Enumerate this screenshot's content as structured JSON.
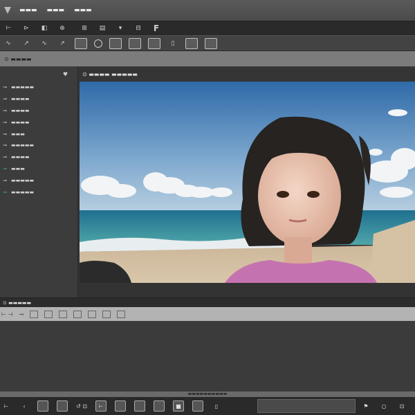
{
  "menubar": {
    "items": [
      "▬▬▬",
      "▬▬▬",
      "▬▬▬"
    ]
  },
  "toolbar1": {
    "tools": [
      "⊢",
      "⊳",
      "◧",
      "⊕",
      "⊞",
      "▤",
      "▾",
      "⊟",
      "F"
    ]
  },
  "toolbar2": {
    "tools": [
      "◦",
      "◦",
      "◦",
      "◦",
      "◦"
    ]
  },
  "strip": {
    "label": "⊙ ▬▬▬▬"
  },
  "left_panel": {
    "items": [
      {
        "icon": "⊸",
        "label": "▬▬▬▬▬",
        "green": false
      },
      {
        "icon": "⊸",
        "label": "▬▬▬▬",
        "green": false
      },
      {
        "icon": "⊸",
        "label": "▬▬▬▬",
        "green": false
      },
      {
        "icon": "⊸",
        "label": "▬▬▬▬",
        "green": false
      },
      {
        "icon": "⊸",
        "label": "▬▬▬",
        "green": false
      },
      {
        "icon": "⊸",
        "label": "▬▬▬▬▬",
        "green": false
      },
      {
        "icon": "⊸",
        "label": "▬▬▬▬",
        "green": false
      },
      {
        "icon": "⊸",
        "label": "▬▬▬",
        "green": true
      },
      {
        "icon": "⊸",
        "label": "▬▬▬▬▬",
        "green": false
      },
      {
        "icon": "⊸",
        "label": "▬▬▬▬▬",
        "green": true
      }
    ]
  },
  "viewer": {
    "title": "⊙ ▬▬▬▬ ▬▬▬▬▬"
  },
  "timeline": {
    "title": "⊙ ▬▬▬▬▬"
  },
  "status": {
    "text": "▬▬▬▬▬▬▬▬▬▬"
  },
  "colors": {
    "accent_green": "#3fc78f",
    "panel": "#3c3c3c",
    "toolbar": "#2a2a2a"
  }
}
